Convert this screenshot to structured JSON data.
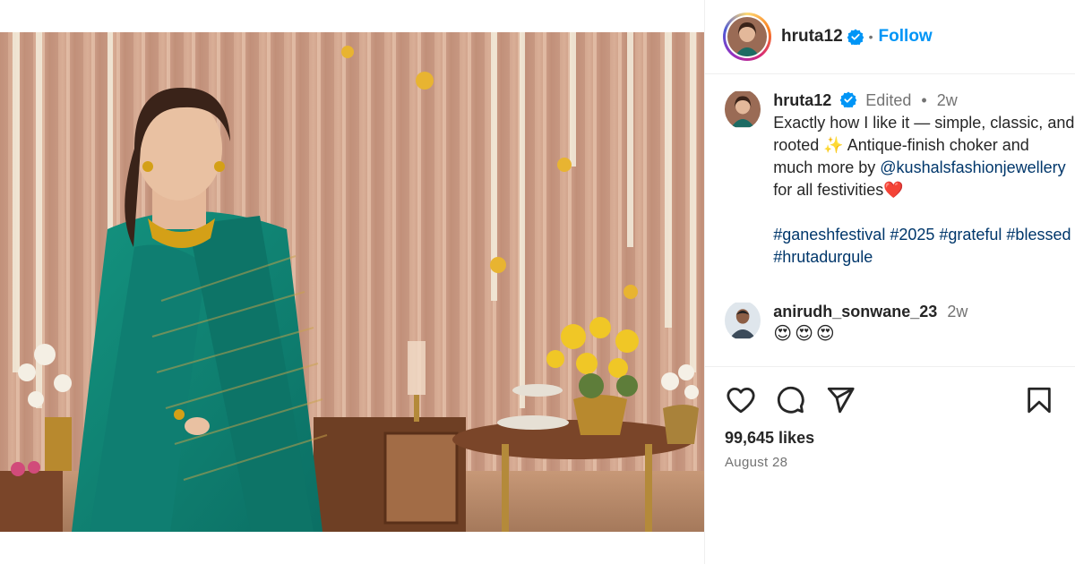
{
  "post": {
    "image_alt": "Woman in teal silk saree with gold choker standing before a festive backdrop"
  },
  "header": {
    "username": "hruta12",
    "separator": "•",
    "follow_label": "Follow"
  },
  "caption": {
    "username": "hruta12",
    "edited_label": "Edited",
    "separator": "•",
    "time": "2w",
    "text_line1": "Exactly how I like it — simple, classic, and",
    "text_line2": "rooted ✨ Antique-finish choker and",
    "text_line3_pre": "much more by ",
    "mention": "@kushalsfashionjewellery",
    "text_line4": "for all festivities❤️",
    "hashtags_line1": "#ganeshfestival #2025 #grateful #blessed",
    "hashtags_line2": "#hrutadurgule"
  },
  "comment": {
    "username": "anirudh_sonwane_23",
    "time": "2w",
    "emojis": "😍😍😍"
  },
  "actions": {
    "likes": "99,645 likes",
    "date": "August 28"
  },
  "colors": {
    "accent": "#0095f6",
    "link": "#00376b",
    "muted": "#737373",
    "saree": "#10877a",
    "gold": "#d4a017"
  },
  "icons": [
    "verified-badge-icon",
    "heart-icon",
    "comment-icon",
    "share-icon",
    "bookmark-icon"
  ]
}
